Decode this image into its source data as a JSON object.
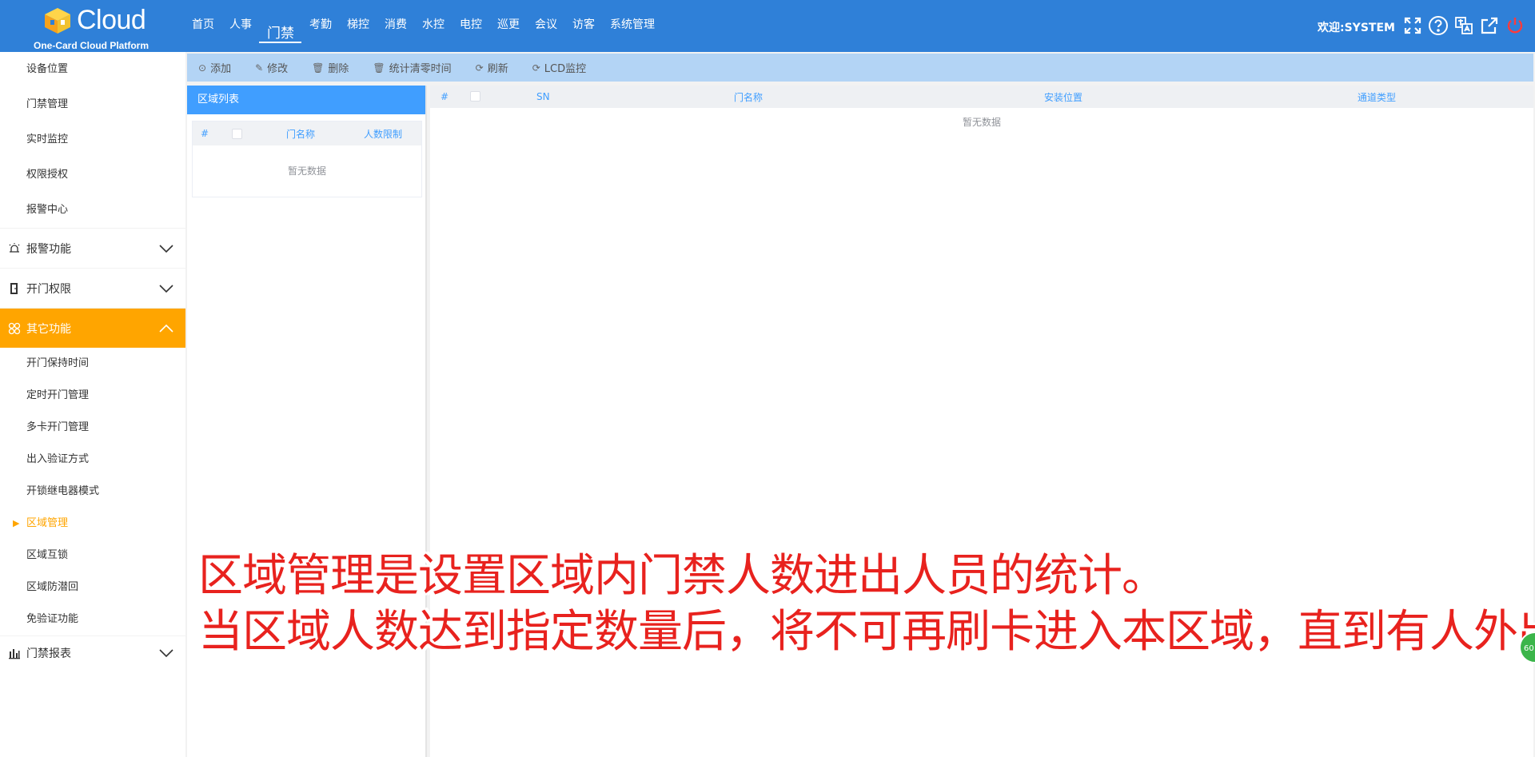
{
  "header": {
    "logo_text": "Cloud",
    "logo_sub": "One-Card Cloud Platform",
    "nav": [
      "首页",
      "人事",
      "门禁",
      "考勤",
      "梯控",
      "消费",
      "水控",
      "电控",
      "巡更",
      "会议",
      "访客",
      "系统管理"
    ],
    "active_nav": "门禁",
    "welcome": "欢迎:SYSTEM",
    "icons": [
      "fullscreen-icon",
      "help-icon",
      "translate-icon",
      "external-link-icon",
      "power-icon"
    ]
  },
  "sidebar": {
    "top_items": [
      "设备位置",
      "门禁管理",
      "实时监控",
      "权限授权",
      "报警中心"
    ],
    "group_alarm": "报警功能",
    "group_open": "开门权限",
    "group_other": "其它功能",
    "other_items": [
      "开门保持时间",
      "定时开门管理",
      "多卡开门管理",
      "出入验证方式",
      "开锁继电器模式",
      "区域管理",
      "区域互锁",
      "区域防潜回",
      "免验证功能"
    ],
    "active_item": "区域管理",
    "group_report": "门禁报表"
  },
  "toolbar": {
    "add": "添加",
    "edit": "修改",
    "delete": "删除",
    "clear_stats": "统计清零时间",
    "refresh": "刷新",
    "lcd": "LCD监控"
  },
  "area_list": {
    "title": "区域列表",
    "columns": [
      "#",
      "门名称",
      "人数限制"
    ],
    "empty": "暂无数据"
  },
  "main_table": {
    "columns": [
      "#",
      "SN",
      "门名称",
      "安装位置",
      "通道类型"
    ],
    "empty": "暂无数据"
  },
  "caption": {
    "line1": "区域管理是设置区域内门禁人数进出人员的统计。",
    "line2": "当区域人数达到指定数量后，将不可再刷卡进入本区域，直到有人外出"
  },
  "badge": "60",
  "colors": {
    "header_bg": "#2f80d8",
    "accent_orange": "#ffa500",
    "table_blue": "#409eff",
    "caption_red": "#e8221e"
  }
}
